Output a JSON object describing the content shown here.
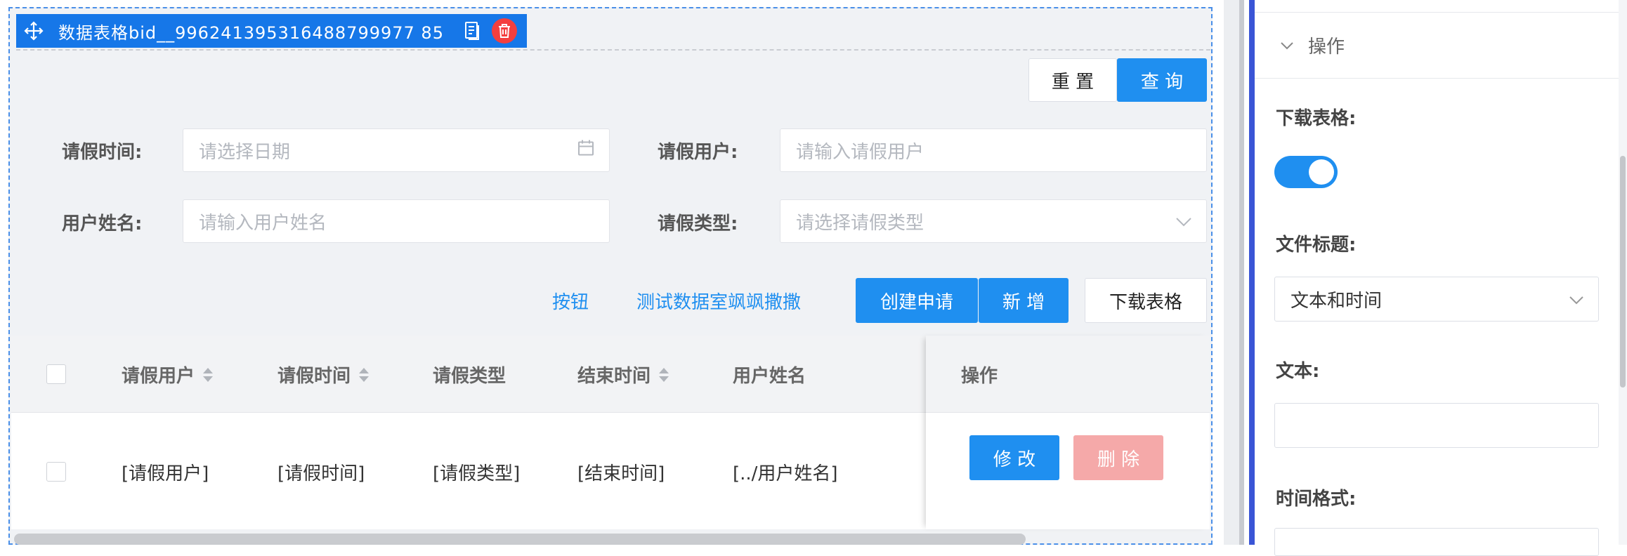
{
  "canvas": {
    "block_title": "数据表格bid__996241395316488799977 85",
    "toolbar": {
      "reset": "重 置",
      "query": "查 询"
    },
    "form": {
      "leave_time_label": "请假时间:",
      "leave_time_placeholder": "请选择日期",
      "leave_user_label": "请假用户:",
      "leave_user_placeholder": "请输入请假用户",
      "user_name_label": "用户姓名:",
      "user_name_placeholder": "请输入用户姓名",
      "leave_type_label": "请假类型:",
      "leave_type_placeholder": "请选择请假类型"
    },
    "actions": {
      "button_link": "按钮",
      "test_link": "测试数据室飒飒撒撒",
      "create": "创建申请",
      "add": "新 增",
      "download": "下载表格"
    },
    "table": {
      "columns": [
        "请假用户",
        "请假时间",
        "请假类型",
        "结束时间",
        "用户姓名",
        "操作"
      ],
      "rows": [
        {
          "user": "[请假用户]",
          "time": "[请假时间]",
          "type": "[请假类型]",
          "end": "[结束时间]",
          "name": "[../用户姓名]"
        }
      ],
      "row_actions": {
        "edit": "修 改",
        "delete": "删 除"
      }
    }
  },
  "panel": {
    "section_title": "操作",
    "download_table_label": "下载表格:",
    "download_table_enabled": true,
    "file_title_label": "文件标题:",
    "file_title_value": "文本和时间",
    "text_label": "文本:",
    "text_value": "",
    "time_format_label": "时间格式:"
  },
  "colors": {
    "primary": "#1f8ff0",
    "header_bar": "#1677e8",
    "danger": "#f43f3f",
    "danger_light": "#f5a9a9"
  }
}
